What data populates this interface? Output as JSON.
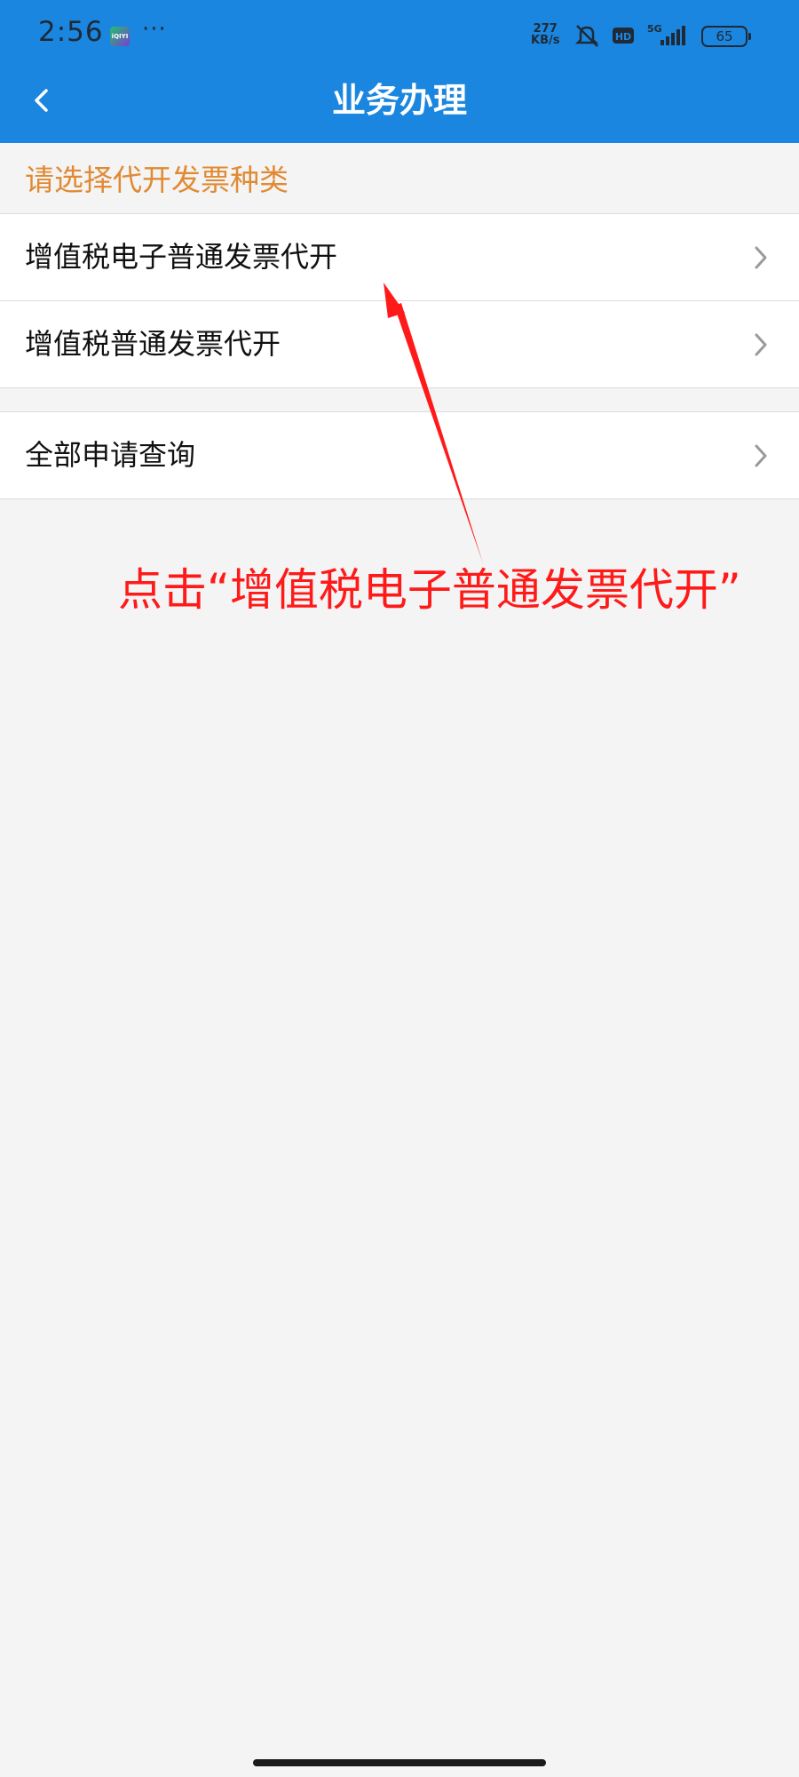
{
  "status_bar": {
    "time": "2:56",
    "app_icon_label": "iQIYI",
    "dots": "···",
    "speed": "277",
    "speed_unit": "KB/s",
    "network": "5G",
    "hd": "HD",
    "battery": "65",
    "icons": [
      "mute-bell-icon",
      "hd-icon",
      "signal-icon",
      "battery-icon"
    ]
  },
  "nav": {
    "title": "业务办理",
    "back_icon": "chevron-left-icon"
  },
  "section": {
    "header": "请选择代开发票种类",
    "items": [
      {
        "label": "增值税电子普通发票代开",
        "icon": "chevron-right-icon"
      },
      {
        "label": "增值税普通发票代开",
        "icon": "chevron-right-icon"
      }
    ]
  },
  "query": {
    "items": [
      {
        "label": "全部申请查询",
        "icon": "chevron-right-icon"
      }
    ]
  },
  "annotation": {
    "text": "点击“增值税电子普通发票代开”",
    "color": "#ff1a1a"
  },
  "colors": {
    "primary": "#1a86df",
    "header_text": "#e18a33",
    "background": "#f4f4f4"
  }
}
